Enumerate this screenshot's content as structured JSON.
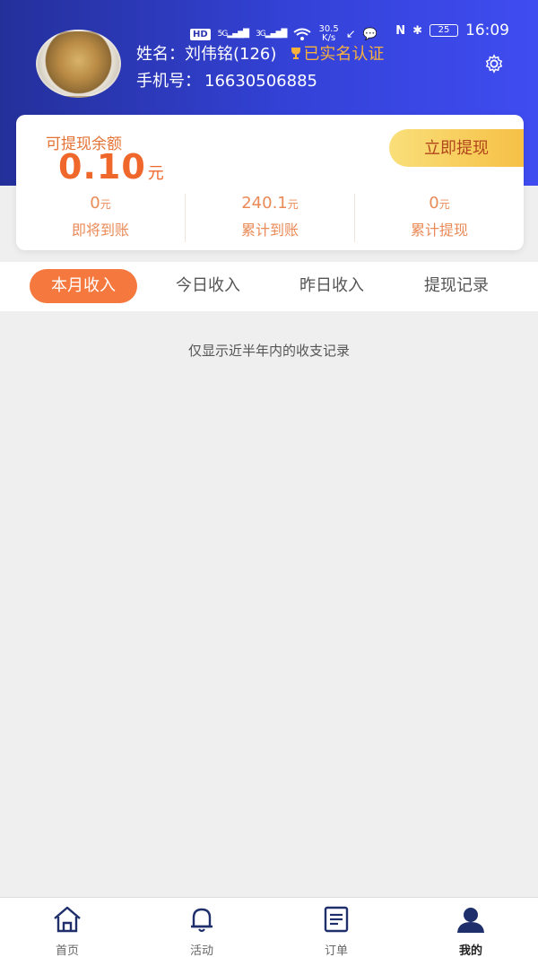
{
  "status_bar": {
    "hd_label": "HD",
    "signal_1": "5G",
    "signal_2": "3G",
    "speed_value": "30.5",
    "speed_unit": "K/s",
    "battery": "25",
    "time": "16:09"
  },
  "user": {
    "name_label": "姓名：",
    "name_value": "刘伟铭(126)",
    "verified_text": "已实名认证",
    "phone_label": "手机号：",
    "phone_value": "16630506885"
  },
  "balance": {
    "label": "可提现余额",
    "value": "0.10",
    "unit": "元",
    "withdraw_button": "立即提现"
  },
  "stats": [
    {
      "value": "0",
      "unit": "元",
      "label": "即将到账"
    },
    {
      "value": "240.1",
      "unit": "元",
      "label": "累计到账"
    },
    {
      "value": "0",
      "unit": "元",
      "label": "累计提现"
    }
  ],
  "tabs": [
    {
      "label": "本月收入",
      "active": true
    },
    {
      "label": "今日收入",
      "active": false
    },
    {
      "label": "昨日收入",
      "active": false
    },
    {
      "label": "提现记录",
      "active": false
    }
  ],
  "hint": "仅显示近半年内的收支记录",
  "bottom_nav": [
    {
      "label": "首页",
      "icon": "home-icon"
    },
    {
      "label": "活动",
      "icon": "bell-icon"
    },
    {
      "label": "订单",
      "icon": "order-icon"
    },
    {
      "label": "我的",
      "icon": "profile-icon",
      "active": true
    }
  ],
  "colors": {
    "header_blue": "#3442d8",
    "accent_orange": "#f5793e",
    "gold": "#f9b13c"
  }
}
